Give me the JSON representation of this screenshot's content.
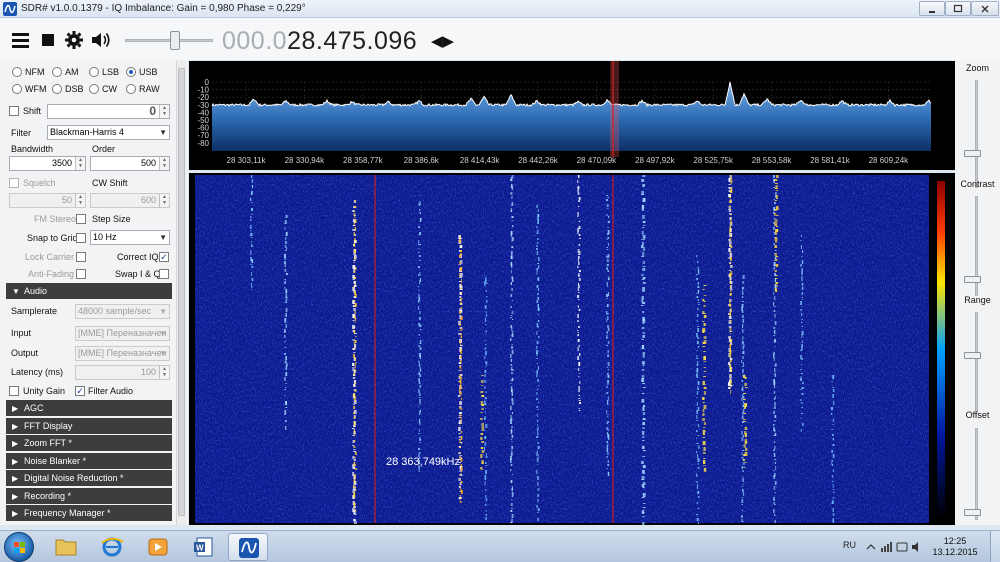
{
  "window": {
    "title": "SDR# v1.0.0.1379 - IQ Imbalance: Gain = 0,980 Phase = 0,229°",
    "minimize_icon": "minimize-icon",
    "maximize_icon": "maximize-icon",
    "close_icon": "close-icon"
  },
  "toolbar": {
    "frequency_dim": "000.0",
    "frequency_main": "28.475.096",
    "volume_level": 0.55
  },
  "modes": {
    "row1": [
      "NFM",
      "AM",
      "LSB",
      "USB"
    ],
    "row2": [
      "WFM",
      "DSB",
      "CW",
      "RAW"
    ],
    "selected": "USB"
  },
  "radio": {
    "shift_label": "Shift",
    "shift_value": "0",
    "filter_label": "Filter",
    "filter_value": "Blackman-Harris 4",
    "bandwidth_label": "Bandwidth",
    "bandwidth_value": "3500",
    "order_label": "Order",
    "order_value": "500",
    "squelch_label": "Squelch",
    "squelch_value": "50",
    "cwshift_label": "CW Shift",
    "cwshift_value": "600",
    "fmstereo_label": "FM Stereo",
    "stepsize_label": "Step Size",
    "snap_label": "Snap to Grid",
    "step_value": "10 Hz",
    "lockcarrier_label": "Lock Carrier",
    "correctiq_label": "Correct IQ",
    "antifading_label": "Anti-Fading",
    "swapiq_label": "Swap I & Q"
  },
  "audio": {
    "section": "Audio",
    "samplerate_label": "Samplerate",
    "samplerate_value": "48000 sample/sec",
    "input_label": "Input",
    "input_value": "[MME] Переназначен",
    "output_label": "Output",
    "output_value": "[MME] Переназначен",
    "latency_label": "Latency (ms)",
    "latency_value": "100",
    "unitygain_label": "Unity Gain",
    "filteraudio_label": "Filter Audio"
  },
  "sections": [
    "AGC",
    "FFT Display",
    "Zoom FFT *",
    "Noise Blanker *",
    "Digital Noise Reduction *",
    "Recording *",
    "Frequency Manager *"
  ],
  "right_panel": {
    "zoom_label": "Zoom",
    "contrast_label": "Contrast",
    "range_label": "Range",
    "offset_label": "Offset"
  },
  "spectrum": {
    "db_ticks": [
      "0",
      "-10",
      "-20",
      "-30",
      "-40",
      "-50",
      "-60",
      "-70",
      "-80"
    ],
    "freq_ticks": [
      "28 303,11k",
      "28 330,94k",
      "28 358,77k",
      "28 386,6k",
      "28 414,43k",
      "28 442,26k",
      "28 470,09k",
      "28 497,92k",
      "28 525,75k",
      "28 553,58k",
      "28 581,41k",
      "28 609,24k"
    ]
  },
  "waterfall": {
    "cursor_label": "28 363,749kHz"
  },
  "taskbar": {
    "start_icon": "windows-start-icon",
    "items": [
      "folder-icon",
      "internet-explorer-icon",
      "media-player-icon",
      "word-icon",
      "sdrsharp-icon"
    ],
    "language": "RU",
    "time": "12:25",
    "date": "13.12.2015"
  },
  "colors": {
    "background": "#000000",
    "spectrum_line": "#ffffff",
    "spectrum_fill_top": "#7fb2e6",
    "spectrum_fill_bottom": "#0d2f66",
    "waterfall_base": "#0c1a8c",
    "cursor_line": "#c81e1e",
    "section_header": "#3d3d3d"
  }
}
